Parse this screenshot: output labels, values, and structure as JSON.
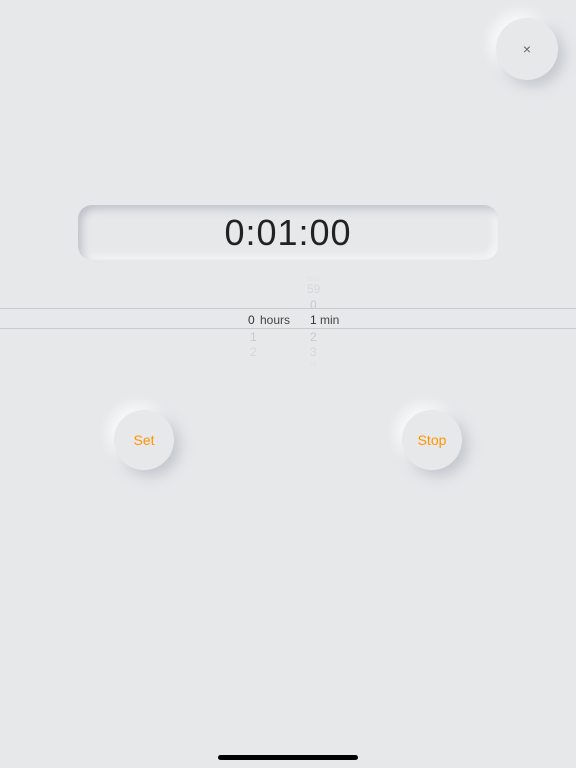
{
  "close": {
    "icon": "×"
  },
  "display": {
    "time": "0:01:00"
  },
  "picker": {
    "hours": {
      "label": "hours",
      "selected": "0",
      "below": [
        "1",
        "2"
      ]
    },
    "minutes": {
      "label": "min",
      "far_above": "58",
      "above": [
        "59",
        "0"
      ],
      "selected": "1",
      "below": [
        "2",
        "3"
      ],
      "far_below": "4"
    }
  },
  "buttons": {
    "set": "Set",
    "stop": "Stop"
  }
}
